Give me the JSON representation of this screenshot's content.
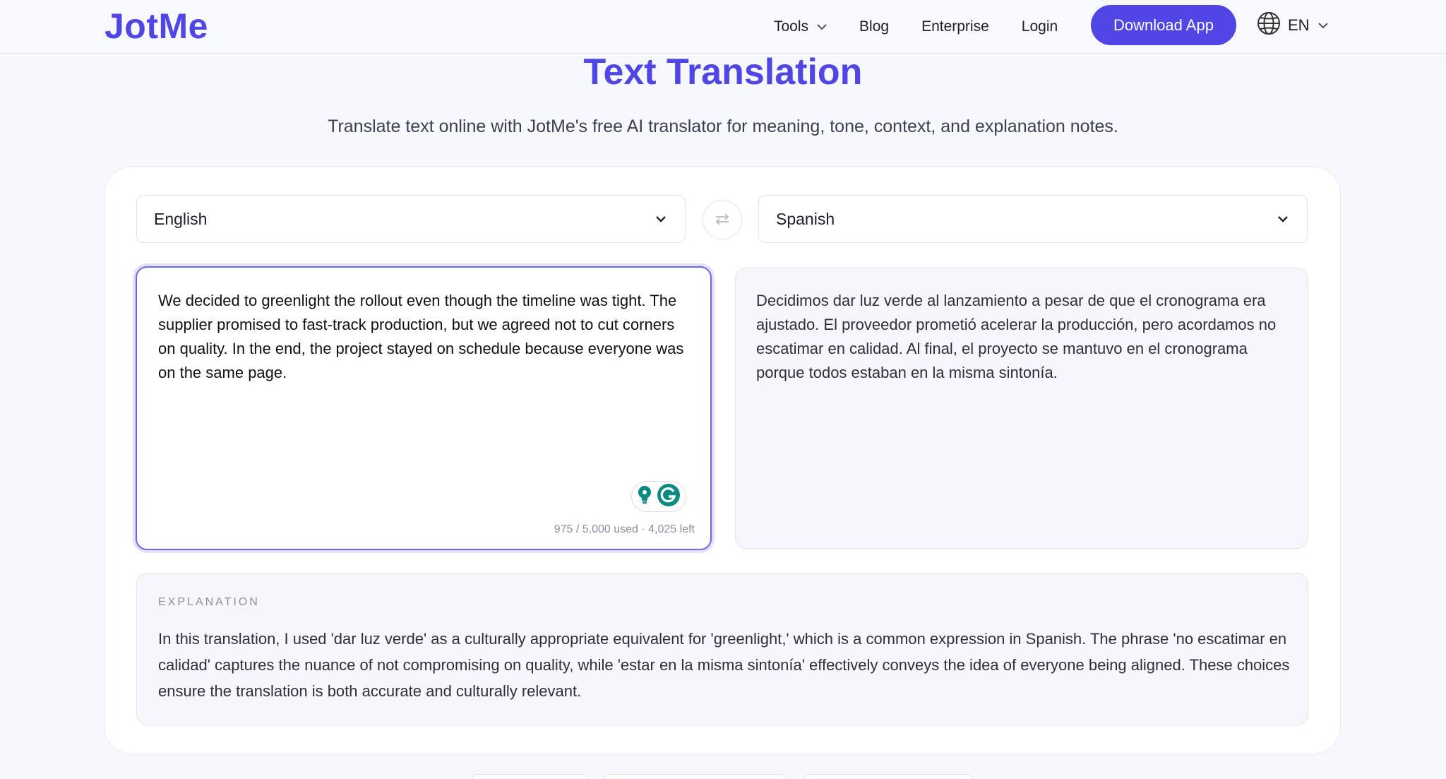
{
  "nav": {
    "logo": "JotMe",
    "links": [
      {
        "label": "Tools",
        "has_dropdown": true
      },
      {
        "label": "Blog"
      },
      {
        "label": "Enterprise"
      },
      {
        "label": "Login"
      }
    ],
    "cta": "Download App",
    "language": "EN"
  },
  "hero": {
    "title": "Text Translation",
    "subtitle": "Translate text online with JotMe's free AI translator for meaning, tone, context, and explanation notes."
  },
  "translator": {
    "source_language": "English",
    "target_language": "Spanish",
    "source_text": "We decided to greenlight the rollout even though the timeline was tight. The supplier promised to fast-track production, but we agreed not to cut corners on quality. In the end, the project stayed on schedule because everyone was on the same page.",
    "char_counter": "975 / 5,000 used · 4,025 left",
    "target_text": "Decidimos dar luz verde al lanzamiento a pesar de que el cronograma era ajustado. El proveedor prometió acelerar la producción, pero acordamos no escatimar en calidad. Al final, el proyecto se mantuvo en el cronograma porque todos estaban en la misma sintonía.",
    "explanation_label": "EXPLANATION",
    "explanation_text": "In this translation, I used 'dar luz verde' as a culturally appropriate equivalent for 'greenlight,' which is a common expression in Spanish. The phrase 'no escatimar en calidad' captures the nuance of not compromising on quality, while 'estar en la misma sintonía' effectively conveys the idea of everyone being aligned. These choices ensure the translation is both accurate and culturally relevant."
  },
  "colors": {
    "brand": "#4f46e5",
    "assist_teal": "#0b8a83"
  },
  "icons": [
    "chevron-down-icon",
    "globe-icon",
    "swap-icon",
    "lightbulb-icon",
    "grammarly-icon"
  ]
}
